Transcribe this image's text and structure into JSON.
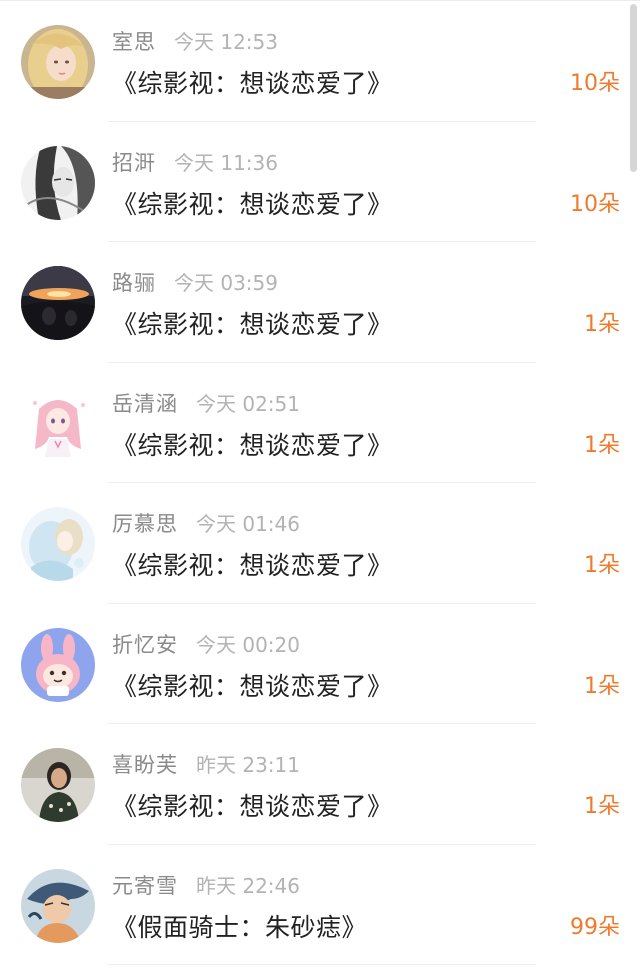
{
  "colors": {
    "count": "#f07a2c",
    "name": "#8a8a8a",
    "time": "#b3b3b3",
    "title": "#222222"
  },
  "rows": [
    {
      "name": "室思",
      "time": "今天 12:53",
      "title": "《综影视：想谈恋爱了》",
      "count": "10朵",
      "avatar": "anime-girl-blonde"
    },
    {
      "name": "招涆",
      "time": "今天 11:36",
      "title": "《综影视：想谈恋爱了》",
      "count": "10朵",
      "avatar": "sketch-portrait"
    },
    {
      "name": "路骊",
      "time": "今天 03:59",
      "title": "《综影视：想谈恋爱了》",
      "count": "1朵",
      "avatar": "car-sunset"
    },
    {
      "name": "岳清涵",
      "time": "今天 02:51",
      "title": "《综影视：想谈恋爱了》",
      "count": "1朵",
      "avatar": "pink-hair-girl"
    },
    {
      "name": "厉慕思",
      "time": "今天 01:46",
      "title": "《综影视：想谈恋爱了》",
      "count": "1朵",
      "avatar": "watercolor-couple"
    },
    {
      "name": "折忆安",
      "time": "今天 00:20",
      "title": "《综影视：想谈恋爱了》",
      "count": "1朵",
      "avatar": "bunny-cartoon"
    },
    {
      "name": "喜盼芙",
      "time": "昨天 23:11",
      "title": "《综影视：想谈恋爱了》",
      "count": "1朵",
      "avatar": "woman-photo"
    },
    {
      "name": "元寄雪",
      "time": "昨天 22:46",
      "title": "《假面骑士：朱砂痣》",
      "count": "99朵",
      "avatar": "anime-boy"
    }
  ]
}
